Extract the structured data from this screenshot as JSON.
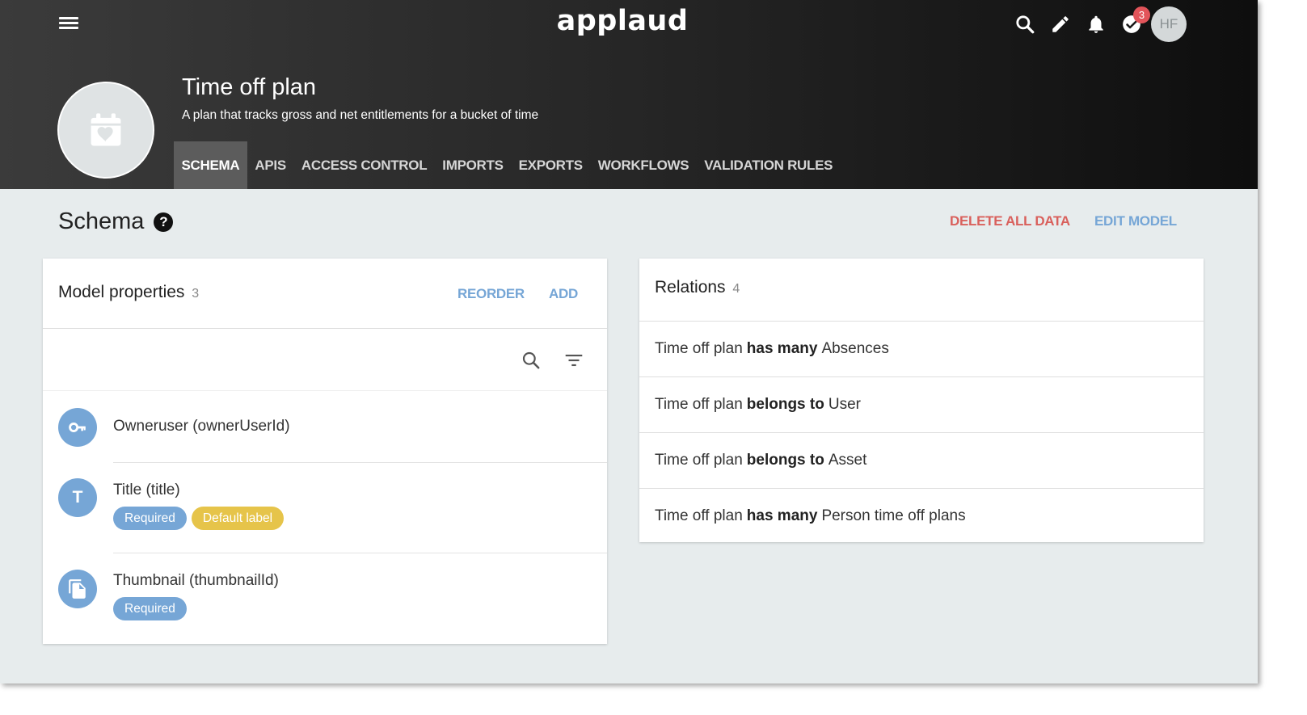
{
  "app": {
    "brand": "applaud"
  },
  "topbar": {
    "notifications_count": "3",
    "user_initials": "HF",
    "icons": [
      "menu-icon",
      "search-icon",
      "pencil-icon",
      "bell-icon",
      "check-circle-icon"
    ]
  },
  "model": {
    "title": "Time off plan",
    "description": "A plan that tracks gross and net entitlements for a bucket of time",
    "icon": "calendar-heart-icon"
  },
  "tabs": [
    {
      "label": "SCHEMA",
      "active": true
    },
    {
      "label": "APIS"
    },
    {
      "label": "ACCESS CONTROL"
    },
    {
      "label": "IMPORTS"
    },
    {
      "label": "EXPORTS"
    },
    {
      "label": "WORKFLOWS"
    },
    {
      "label": "VALIDATION RULES"
    }
  ],
  "page": {
    "title": "Schema",
    "help": "?",
    "delete_all": "DELETE ALL DATA",
    "edit_model": "EDIT MODEL"
  },
  "properties": {
    "title": "Model properties",
    "count": "3",
    "reorder": "REORDER",
    "add": "ADD",
    "items": [
      {
        "name": "Owneruser (ownerUserId)",
        "icon": "key-icon",
        "chips": []
      },
      {
        "name": "Title (title)",
        "icon": "text-type-icon",
        "icon_text": "T",
        "chips": [
          "Required",
          "Default label"
        ]
      },
      {
        "name": "Thumbnail (thumbnailId)",
        "icon": "file-copy-icon",
        "chips": [
          "Required"
        ]
      }
    ]
  },
  "relations": {
    "title": "Relations",
    "count": "4",
    "items": [
      {
        "subject": "Time off plan",
        "kind": "has many",
        "target": "Absences"
      },
      {
        "subject": "Time off plan",
        "kind": "belongs to",
        "target": "User"
      },
      {
        "subject": "Time off plan",
        "kind": "belongs to",
        "target": "Asset"
      },
      {
        "subject": "Time off plan",
        "kind": "has many",
        "target": "Person time off plans"
      }
    ]
  },
  "colors": {
    "accent": "#76a6d6",
    "danger": "#d9605c",
    "chip_default": "#e6c44a",
    "badge": "#e2545a",
    "page_bg": "#e7eced"
  }
}
